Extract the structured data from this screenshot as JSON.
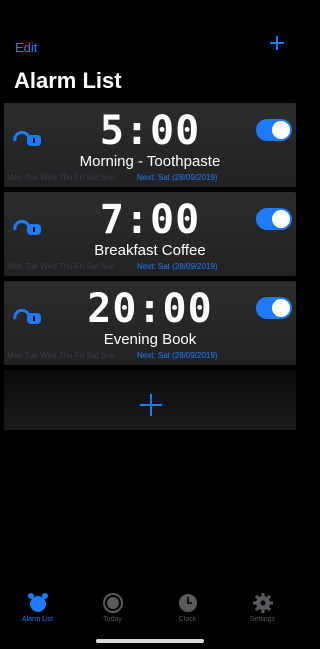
{
  "header": {
    "edit_label": "Edit",
    "title": "Alarm List"
  },
  "alarms": [
    {
      "time": "5:00",
      "label": "Morning - Toothpaste",
      "days": "Mon Tue Wed Thu Fri Sat Sun",
      "next": "Next: Sat (28/09/2019)",
      "enabled": true
    },
    {
      "time": "7:00",
      "label": "Breakfast Coffee",
      "days": "Mon Tue Wed Thu Fri Sat Sun",
      "next": "Next: Sat (28/09/2019)",
      "enabled": true
    },
    {
      "time": "20:00",
      "label": "Evening Book",
      "days": "Mon Tue Wed Thu Fri Sat Sun",
      "next": "Next: Sat (28/09/2019)",
      "enabled": true
    }
  ],
  "tabs": [
    {
      "label": "Alarm List",
      "icon": "alarm-clock-icon",
      "active": true
    },
    {
      "label": "Today",
      "icon": "today-circle-icon",
      "active": false
    },
    {
      "label": "Clock",
      "icon": "clock-icon",
      "active": false
    },
    {
      "label": "Settings",
      "icon": "gear-icon",
      "active": false
    }
  ],
  "colors": {
    "accent": "#1e7bff",
    "background": "#000000",
    "card": "#2c2c2e",
    "inactive_tab": "#5a5a5e"
  }
}
